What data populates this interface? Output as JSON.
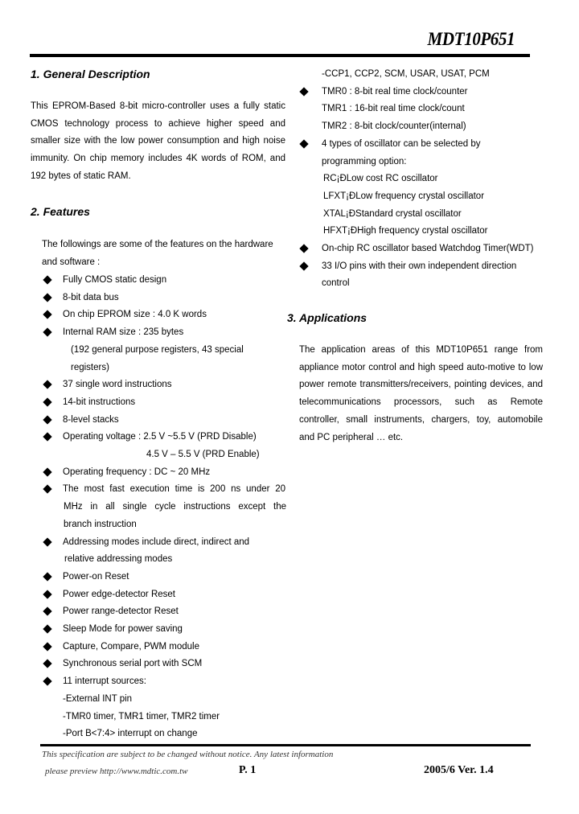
{
  "header": {
    "title": "MDT10P651"
  },
  "sections": {
    "general": {
      "heading": "1. General Description",
      "lines": [
        "This EPROM-Based 8-bit micro-controller uses a fully static",
        "CMOS technology process to achieve higher speed and",
        "smaller size with the low power consumption and high noise",
        "immunity. On chip memory includes 4K words of ROM, and",
        "192 bytes of static RAM."
      ]
    },
    "features": {
      "heading": "2. Features",
      "intro": [
        "The followings are some of the features on the hardware",
        "and software :"
      ],
      "left_items": [
        {
          "text": "Fully CMOS static design",
          "bullet": true
        },
        {
          "text": "8-bit data bus",
          "bullet": true
        },
        {
          "text": "On chip EPROM size : 4.0 K words",
          "bullet": true
        },
        {
          "text": "Internal RAM size : 235 bytes",
          "bullet": true
        },
        {
          "text": "(192 general purpose registers, 43 special",
          "bullet": false
        },
        {
          "text": "registers)",
          "bullet": false
        },
        {
          "text": "37 single word instructions",
          "bullet": true
        },
        {
          "text": "14-bit instructions",
          "bullet": true
        },
        {
          "text": "8-level stacks",
          "bullet": true
        },
        {
          "text": "Operating voltage : 2.5 V ~5.5 V (PRD Disable)",
          "bullet": true
        },
        {
          "text": "4.5 V – 5.5 V (PRD Enable)",
          "bullet": false
        },
        {
          "text": "Operating frequency : DC ~ 20 MHz",
          "bullet": true
        },
        {
          "text": "The most fast execution time is 200 ns under 20",
          "bullet": true
        },
        {
          "text": "MHz in all single cycle instructions except the",
          "bullet": false
        },
        {
          "text": "branch instruction",
          "bullet": false
        },
        {
          "text": "Addressing modes include direct, indirect and",
          "bullet": true
        },
        {
          "text": "relative addressing modes",
          "bullet": false
        },
        {
          "text": "Power-on Reset",
          "bullet": true
        },
        {
          "text": "Power edge-detector Reset",
          "bullet": true
        },
        {
          "text": "Power range-detector Reset",
          "bullet": true
        },
        {
          "text": "Sleep Mode for power saving",
          "bullet": true
        },
        {
          "text": "Capture, Compare, PWM module",
          "bullet": true
        },
        {
          "text": "Synchronous serial port with SCM",
          "bullet": true
        },
        {
          "text": "11 interrupt sources:",
          "bullet": true
        },
        {
          "text": "-External INT pin",
          "bullet": false
        },
        {
          "text": "-TMR0 timer, TMR1 timer, TMR2 timer",
          "bullet": false
        },
        {
          "text": "-Port B<7:4> interrupt on change",
          "bullet": false
        }
      ],
      "right_items": [
        {
          "text": "-CCP1, CCP2, SCM, USAR, USAT, PCM",
          "bullet": false
        },
        {
          "text": "TMR0 : 8-bit real time clock/counter",
          "bullet": true
        },
        {
          "text": "TMR1 : 16-bit real time clock/count",
          "bullet": false
        },
        {
          "text": "TMR2 : 8-bit clock/counter(internal)",
          "bullet": false
        },
        {
          "text": "4 types of oscillator can be selected by",
          "bullet": true
        },
        {
          "text": "programming option:",
          "bullet": false
        },
        {
          "text": "RC¡ÐLow cost RC oscillator",
          "bullet": false
        },
        {
          "text": "LFXT¡ÐLow frequency crystal oscillator",
          "bullet": false
        },
        {
          "text": "XTAL¡ÐStandard crystal oscillator",
          "bullet": false
        },
        {
          "text": "HFXT¡ÐHigh frequency crystal oscillator",
          "bullet": false
        },
        {
          "text": "On-chip RC oscillator based Watchdog Timer(WDT)",
          "bullet": true
        },
        {
          "text": "33 I/O pins with their own independent direction",
          "bullet": true
        },
        {
          "text": "control",
          "bullet": false
        }
      ]
    },
    "applications": {
      "heading": "3. Applications",
      "lines": [
        "The application areas of this MDT10P651 range from",
        "appliance motor control and high speed auto-motive to low",
        "power remote transmitters/receivers, pointing devices, and",
        "telecommunications processors, such as Remote",
        "controller, small instruments, chargers, toy, automobile",
        "and PC peripheral … etc."
      ]
    }
  },
  "footer": {
    "notice": "This specification are subject to be changed without notice. Any latest information",
    "url_line": "please preview http://www.mdtic.com.tw",
    "page": "P. 1",
    "version": "2005/6  Ver.  1.4"
  }
}
